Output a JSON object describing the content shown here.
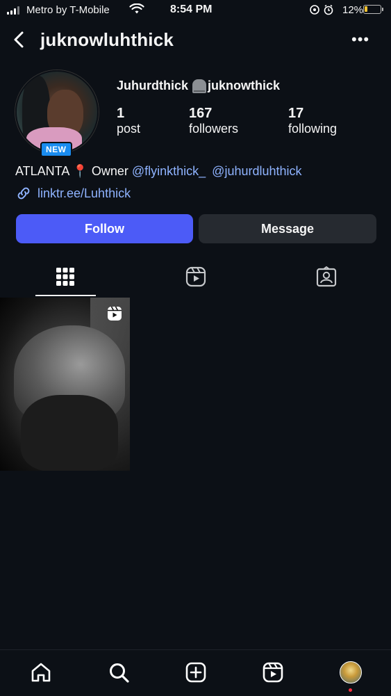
{
  "status_bar": {
    "carrier": "Metro by T-Mobile",
    "time": "8:54 PM",
    "battery_percent": "12%",
    "battery_color": "#f2c230"
  },
  "header": {
    "username": "juknowluhthick",
    "back_icon": "chevron-left-icon",
    "more_icon": "more-horizontal-icon",
    "more_glyph": "•••"
  },
  "profile": {
    "badge": "NEW",
    "full_name": "Juhurdthick",
    "threads_handle": "juknowthick",
    "stats": [
      {
        "value": "1",
        "label": "post"
      },
      {
        "value": "167",
        "label": "followers"
      },
      {
        "value": "17",
        "label": "following"
      }
    ],
    "bio": {
      "text_prefix": "ATLANTA",
      "pin_emoji": "📍",
      "text_middle": "Owner",
      "mention_1": "@flyinkthick_",
      "mention_2": "@juhurdluhthick"
    },
    "link": "linktr.ee/Luhthick"
  },
  "actions": {
    "follow_label": "Follow",
    "message_label": "Message",
    "follow_color": "#4c5bf7"
  },
  "tabs": [
    {
      "icon": "grid-icon",
      "active": true
    },
    {
      "icon": "reels-icon",
      "active": false
    },
    {
      "icon": "tagged-icon",
      "active": false
    }
  ],
  "posts": [
    {
      "type": "reel"
    }
  ],
  "bottom_nav": [
    {
      "icon": "home-icon"
    },
    {
      "icon": "search-icon"
    },
    {
      "icon": "create-icon"
    },
    {
      "icon": "reels-icon"
    },
    {
      "icon": "profile-avatar"
    }
  ]
}
